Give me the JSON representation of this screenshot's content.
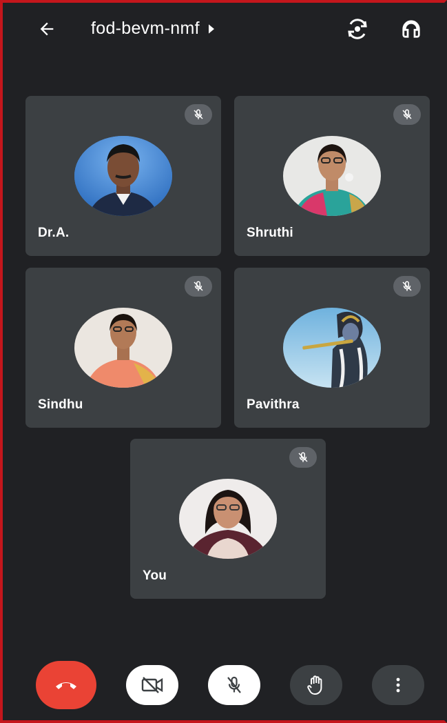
{
  "header": {
    "meeting_code": "fod-bevm-nmf",
    "back_icon": "arrow-back-icon",
    "info_icon": "caret-right-icon",
    "switch_camera_icon": "switch-camera-icon",
    "audio_output_icon": "headphones-icon"
  },
  "participants": [
    {
      "name": "Dr.A.",
      "muted": true
    },
    {
      "name": "Shruthi",
      "muted": true
    },
    {
      "name": "Sindhu",
      "muted": true
    },
    {
      "name": "Pavithra",
      "muted": true
    },
    {
      "name": "You",
      "muted": true
    }
  ],
  "controls": {
    "end_call_icon": "end-call-icon",
    "camera_icon": "camera-off-icon",
    "mic_icon": "mic-off-icon",
    "raise_hand_icon": "raise-hand-icon",
    "more_icon": "more-vert-icon"
  },
  "colors": {
    "background": "#202124",
    "tile": "#3c4043",
    "end_call": "#ea4335",
    "frame_border": "#c4161c"
  }
}
